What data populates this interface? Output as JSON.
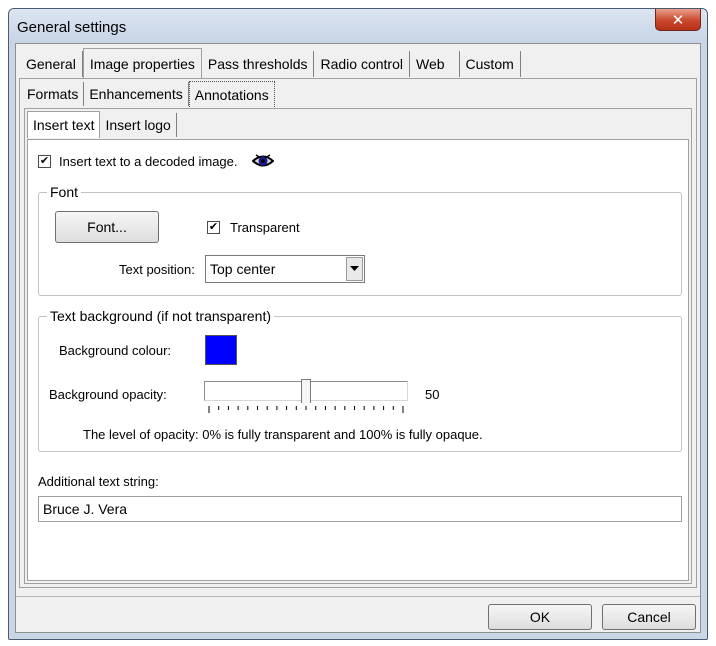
{
  "window": {
    "title": "General settings",
    "close_symbol": "✕"
  },
  "main_tabs": [
    {
      "label": "General"
    },
    {
      "label": "Image properties",
      "active": true
    },
    {
      "label": "Pass thresholds"
    },
    {
      "label": "Radio control"
    },
    {
      "label": "Web"
    },
    {
      "label": "Custom"
    }
  ],
  "sub_tabs": [
    {
      "label": "Formats"
    },
    {
      "label": "Enhancements"
    },
    {
      "label": "Annotations",
      "active": true
    }
  ],
  "inner_tabs": [
    {
      "label": "Insert text",
      "active": true
    },
    {
      "label": "Insert logo"
    }
  ],
  "insert_text": {
    "checkbox_label": "Insert text to a decoded image.",
    "checked": true,
    "check_mark": "✔",
    "icon": "eye-icon"
  },
  "font_group": {
    "legend": "Font",
    "font_button": "Font...",
    "transparent_label": "Transparent",
    "transparent_checked": true,
    "text_position_label": "Text position:",
    "text_position_value": "Top center"
  },
  "background_group": {
    "legend": "Text background (if not transparent)",
    "colour_label": "Background colour:",
    "colour": "#0000ff",
    "opacity_label": "Background opacity:",
    "opacity_value": "50",
    "opacity_fraction": 0.5,
    "note": "The level of opacity: 0% is fully transparent and 100% is fully opaque."
  },
  "additional_text": {
    "label": "Additional text string:",
    "value": "Bruce J. Vera"
  },
  "buttons": {
    "ok": "OK",
    "cancel": "Cancel"
  }
}
